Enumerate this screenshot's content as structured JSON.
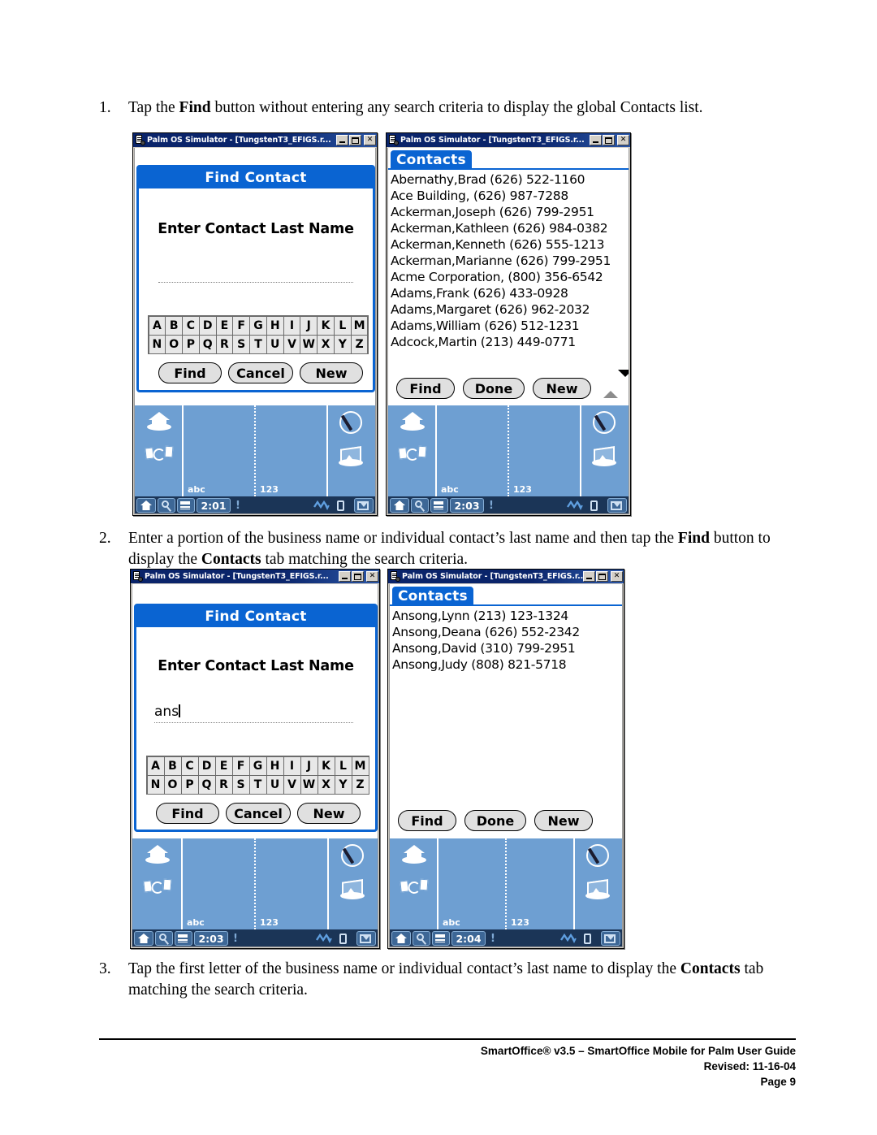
{
  "document": {
    "steps": [
      {
        "number": "1.",
        "parts": [
          {
            "t": "Tap the ",
            "b": false
          },
          {
            "t": "Find",
            "b": true
          },
          {
            "t": " button without entering any search criteria to display the global Contacts list.",
            "b": false
          }
        ]
      },
      {
        "number": "2.",
        "parts": [
          {
            "t": "Enter a portion of the business name or individual contact’s last name and then tap the ",
            "b": false
          },
          {
            "t": "Find",
            "b": true
          },
          {
            "t": " button to display the ",
            "b": false
          },
          {
            "t": "Contacts",
            "b": true
          },
          {
            "t": " tab matching the search criteria.",
            "b": false
          }
        ]
      },
      {
        "number": "3.",
        "parts": [
          {
            "t": "Tap the first letter of the business name or individual contact’s last name to display the ",
            "b": false
          },
          {
            "t": "Contacts",
            "b": true
          },
          {
            "t": " tab matching the search criteria.",
            "b": false
          }
        ]
      }
    ],
    "footer": {
      "line1": "SmartOffice® v3.5 – SmartOffice Mobile for Palm User Guide",
      "line2": "Revised: 11-16-04",
      "line3": "Page 9"
    }
  },
  "window_title": "Palm OS Simulator - [TungstenT3_EFIGS.r...",
  "window_buttons": {
    "minimize": "minimize-button",
    "maximize": "maximize-button",
    "close": "✕"
  },
  "keyboard": {
    "row1": [
      "A",
      "B",
      "C",
      "D",
      "E",
      "F",
      "G",
      "H",
      "I",
      "J",
      "K",
      "L",
      "M"
    ],
    "row2": [
      "N",
      "O",
      "P",
      "Q",
      "R",
      "S",
      "T",
      "U",
      "V",
      "W",
      "X",
      "Y",
      "Z"
    ]
  },
  "graffiti": {
    "abc": "abc",
    "num": "123"
  },
  "screens": {
    "find_empty": {
      "dialog_title": "Find Contact",
      "prompt": "Enter Contact Last Name",
      "input_value": "",
      "buttons": [
        "Find",
        "Cancel",
        "New"
      ],
      "time": "2:01"
    },
    "contacts_global": {
      "tab_label": "Contacts",
      "rows": [
        "Abernathy,Brad (626)  522-1160",
        "Ace Building,  (626) 987-7288",
        "Ackerman,Joseph (626)  799-2951",
        "Ackerman,Kathleen (626) 984-0382",
        "Ackerman,Kenneth (626) 555-1213",
        "Ackerman,Marianne (626)  799-2951",
        "Acme Corporation, (800) 356-6542",
        "Adams,Frank (626) 433-0928",
        "Adams,Margaret (626) 962-2032",
        "Adams,William (626) 512-1231",
        "Adcock,Martin (213) 449-0771"
      ],
      "buttons": [
        "Find",
        "Done",
        "New"
      ],
      "time": "2:03"
    },
    "find_typed": {
      "dialog_title": "Find Contact",
      "prompt": "Enter Contact Last Name",
      "input_value": "ans",
      "buttons": [
        "Find",
        "Cancel",
        "New"
      ],
      "time": "2:03"
    },
    "contacts_filtered": {
      "tab_label": "Contacts",
      "rows": [
        "Ansong,Lynn (213) 123-1324",
        "Ansong,Deana (626) 552-2342",
        "Ansong,David (310) 799-2951",
        "Ansong,Judy (808) 821-5718"
      ],
      "buttons": [
        "Find",
        "Done",
        "New"
      ],
      "time": "2:04"
    }
  },
  "colors": {
    "palm_blue": "#0a64d2",
    "titlebar_blue": "#0a246a",
    "graffiti_blue": "#6e9fd2",
    "statusbar_navy": "#1b3557"
  }
}
